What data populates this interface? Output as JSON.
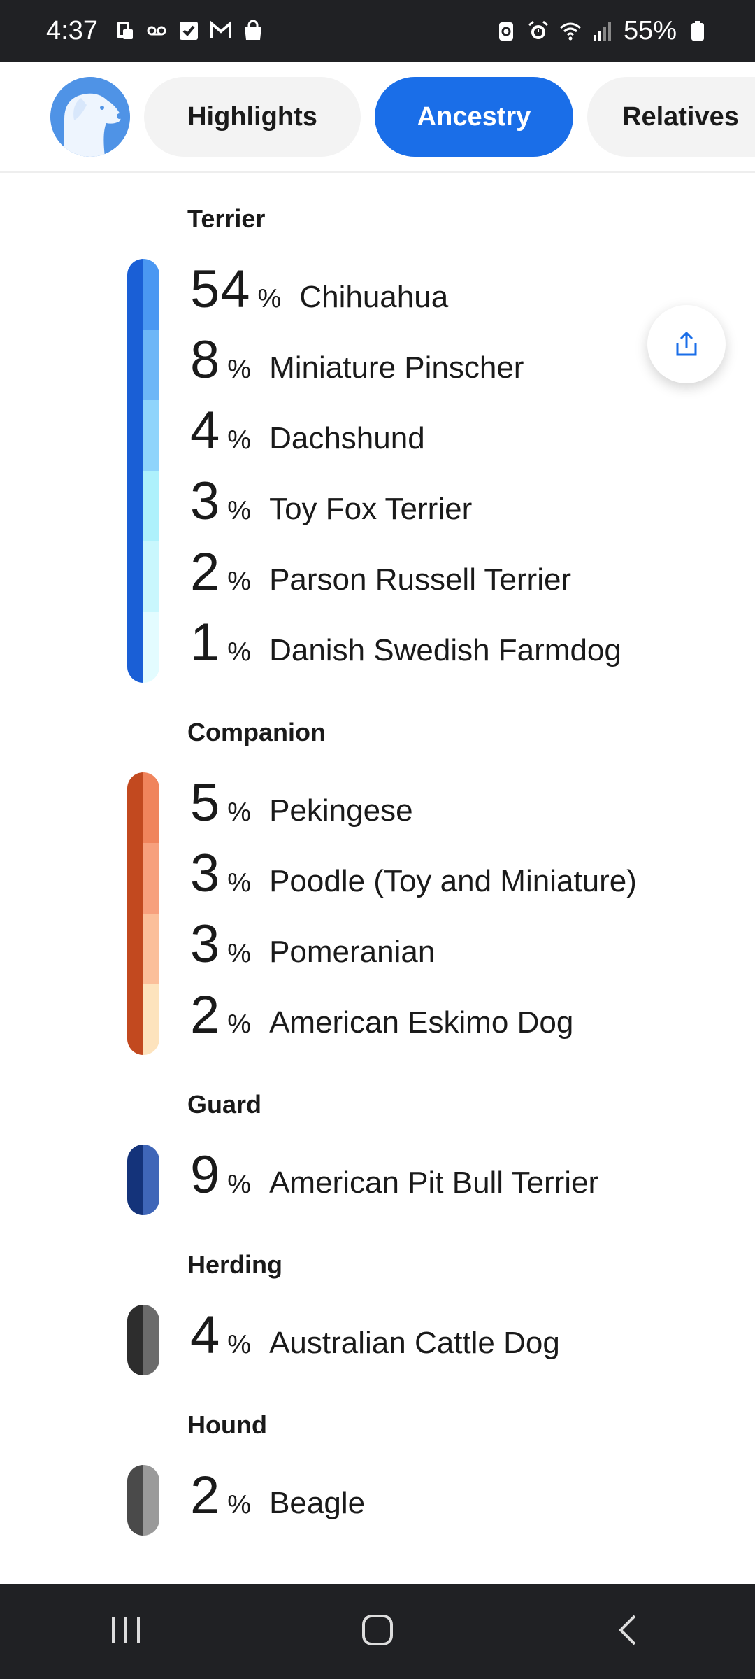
{
  "status_bar": {
    "time": "4:37",
    "battery": "55%"
  },
  "tabs": [
    {
      "label": "Highlights",
      "active": false
    },
    {
      "label": "Ancestry",
      "active": true
    },
    {
      "label": "Relatives",
      "active": false
    }
  ],
  "groups": [
    {
      "title": "Terrier",
      "color_dark": "#1a5fd6",
      "breeds": [
        {
          "percent": "54",
          "name": "Chihuahua",
          "color": "#4a97f2"
        },
        {
          "percent": "8",
          "name": "Miniature Pinscher",
          "color": "#6db6f7"
        },
        {
          "percent": "4",
          "name": "Dachshund",
          "color": "#8fd4fb"
        },
        {
          "percent": "3",
          "name": "Toy Fox Terrier",
          "color": "#aef1fc"
        },
        {
          "percent": "2",
          "name": "Parson Russell Terrier",
          "color": "#c9f7fd"
        },
        {
          "percent": "1",
          "name": "Danish Swedish Farmdog",
          "color": "#e3fcff"
        }
      ]
    },
    {
      "title": "Companion",
      "color_dark": "#c2491f",
      "breeds": [
        {
          "percent": "5",
          "name": "Pekingese",
          "color": "#f0845c"
        },
        {
          "percent": "3",
          "name": "Poodle (Toy and Miniature)",
          "color": "#f7a07d"
        },
        {
          "percent": "3",
          "name": "Pomeranian",
          "color": "#fbbf9a"
        },
        {
          "percent": "2",
          "name": "American Eskimo Dog",
          "color": "#fde3bd"
        }
      ]
    },
    {
      "title": "Guard",
      "color_dark": "#14337a",
      "breeds": [
        {
          "percent": "9",
          "name": "American Pit Bull Terrier",
          "color": "#3f66b8"
        }
      ]
    },
    {
      "title": "Herding",
      "color_dark": "#2d2d2d",
      "breeds": [
        {
          "percent": "4",
          "name": "Australian Cattle Dog",
          "color": "#6b6b6b"
        }
      ]
    },
    {
      "title": "Hound",
      "color_dark": "#4a4a4a",
      "breeds": [
        {
          "percent": "2",
          "name": "Beagle",
          "color": "#9a9a9a"
        }
      ]
    }
  ],
  "icons": {
    "status_left": [
      "phone-icon",
      "voicemail-icon",
      "checkbox-icon",
      "gmail-icon",
      "shopping-bag-icon"
    ],
    "status_right": [
      "battery-saver-icon",
      "alarm-icon",
      "wifi-icon",
      "signal-icon",
      "battery-icon"
    ],
    "avatar": "dog-avatar-icon",
    "share": "share-icon",
    "nav": [
      "recent-apps-icon",
      "home-icon",
      "back-icon"
    ]
  }
}
